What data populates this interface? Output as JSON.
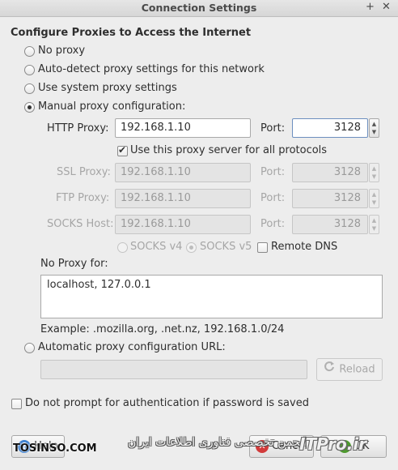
{
  "window": {
    "title": "Connection Settings",
    "add_glyph": "+",
    "close_glyph": "✕"
  },
  "heading": "Configure Proxies to Access the Internet",
  "proxy_options": {
    "no_proxy": "No proxy",
    "auto_detect": "Auto-detect proxy settings for this network",
    "system": "Use system proxy settings",
    "manual": "Manual proxy configuration:",
    "selected": "manual"
  },
  "http": {
    "label": "HTTP Proxy:",
    "host": "192.168.1.10",
    "port_label": "Port:",
    "port": "3128"
  },
  "use_for_all": {
    "label": "Use this proxy server for all protocols",
    "checked": true
  },
  "ssl": {
    "label": "SSL Proxy:",
    "host": "192.168.1.10",
    "port_label": "Port:",
    "port": "3128"
  },
  "ftp": {
    "label": "FTP Proxy:",
    "host": "192.168.1.10",
    "port_label": "Port:",
    "port": "3128"
  },
  "socks": {
    "label": "SOCKS Host:",
    "host": "192.168.1.10",
    "port_label": "Port:",
    "port": "3128"
  },
  "socks_version": {
    "v4": "SOCKS v4",
    "v5": "SOCKS v5",
    "selected": "v5"
  },
  "remote_dns": {
    "label": "Remote DNS",
    "checked": false
  },
  "no_proxy_for": {
    "label": "No Proxy for:",
    "value": "localhost, 127.0.0.1"
  },
  "example": "Example: .mozilla.org, .net.nz, 192.168.1.0/24",
  "auto_config": {
    "label": "Automatic proxy configuration URL:",
    "value": ""
  },
  "reload_button": "Reload",
  "no_prompt_auth": {
    "label": "Do not prompt for authentication if password is saved",
    "checked": false
  },
  "buttons": {
    "help": "Help",
    "cancel": "Cancel",
    "ok": "OK"
  },
  "watermark": {
    "left": "TOSINSO.COM",
    "middle": "انجمن تخصصی فناوری اطلاعات ایران",
    "brand": "ITPro.ir"
  },
  "icons": {
    "help": "help-icon",
    "cancel": "cancel-icon",
    "ok": "ok-icon",
    "reload": "reload-icon",
    "spin_up": "▲",
    "spin_down": "▼"
  }
}
